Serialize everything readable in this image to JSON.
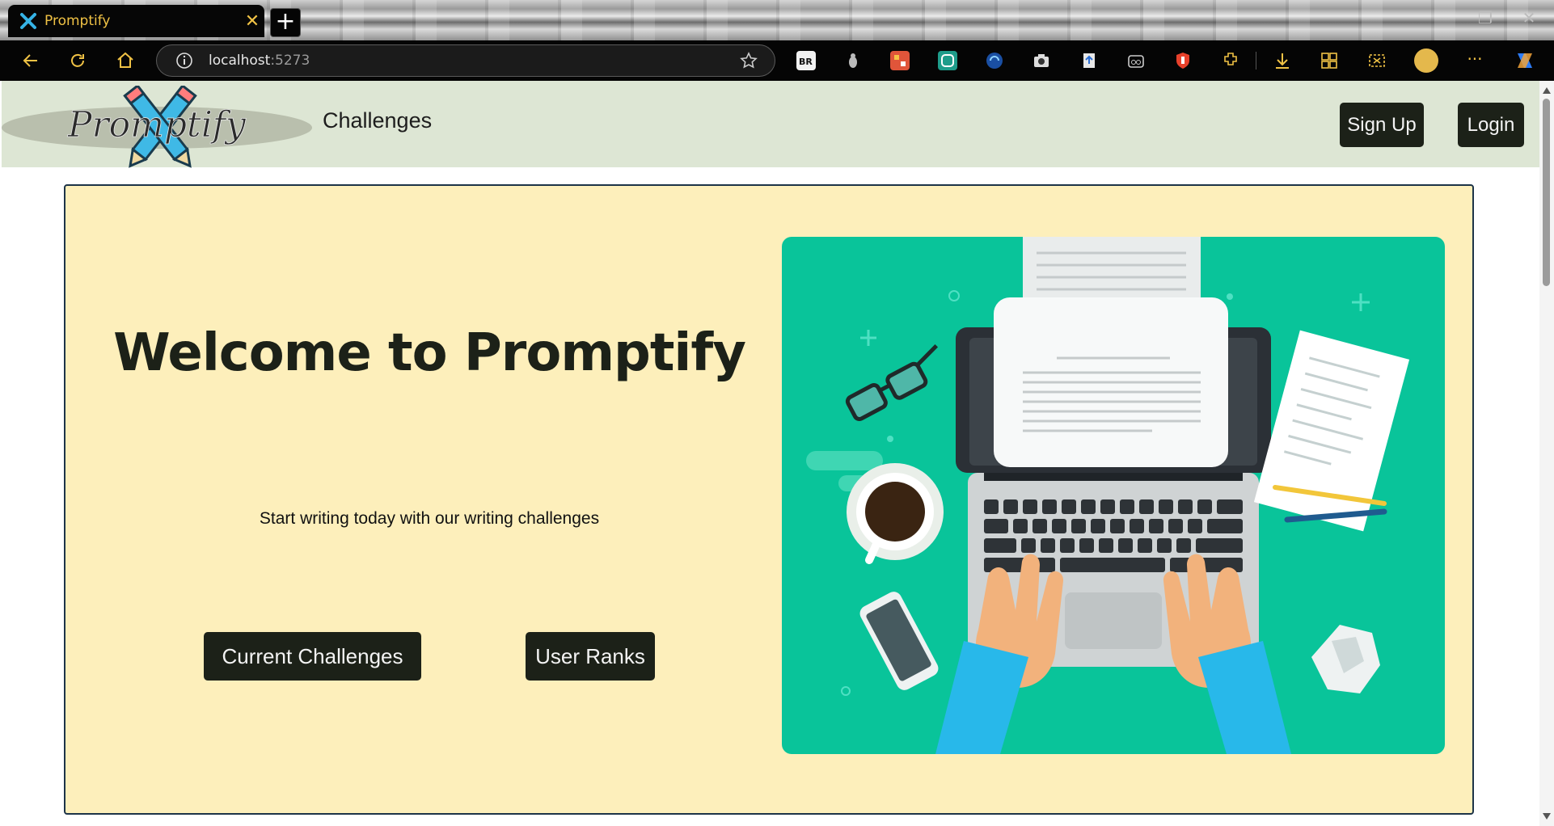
{
  "browser": {
    "tab_title": "Promptify",
    "tab_close": "✕",
    "new_tab": "+",
    "url_host": "localhost",
    "url_port": ":5273",
    "menu_label": "···"
  },
  "header": {
    "logo_text": "Promptify",
    "nav_challenges": "Challenges",
    "signup_label": "Sign Up",
    "login_label": "Login"
  },
  "hero": {
    "title": "Welcome to Promptify",
    "subtitle": "Start writing today with our writing challenges",
    "current_challenges_label": "Current Challenges",
    "user_ranks_label": "User Ranks"
  },
  "colors": {
    "header_bg": "#dde6d4",
    "hero_bg": "#fdefbb",
    "button_bg": "#1c2118",
    "illustration_bg": "#09c49a",
    "tab_text": "#f0c245"
  }
}
